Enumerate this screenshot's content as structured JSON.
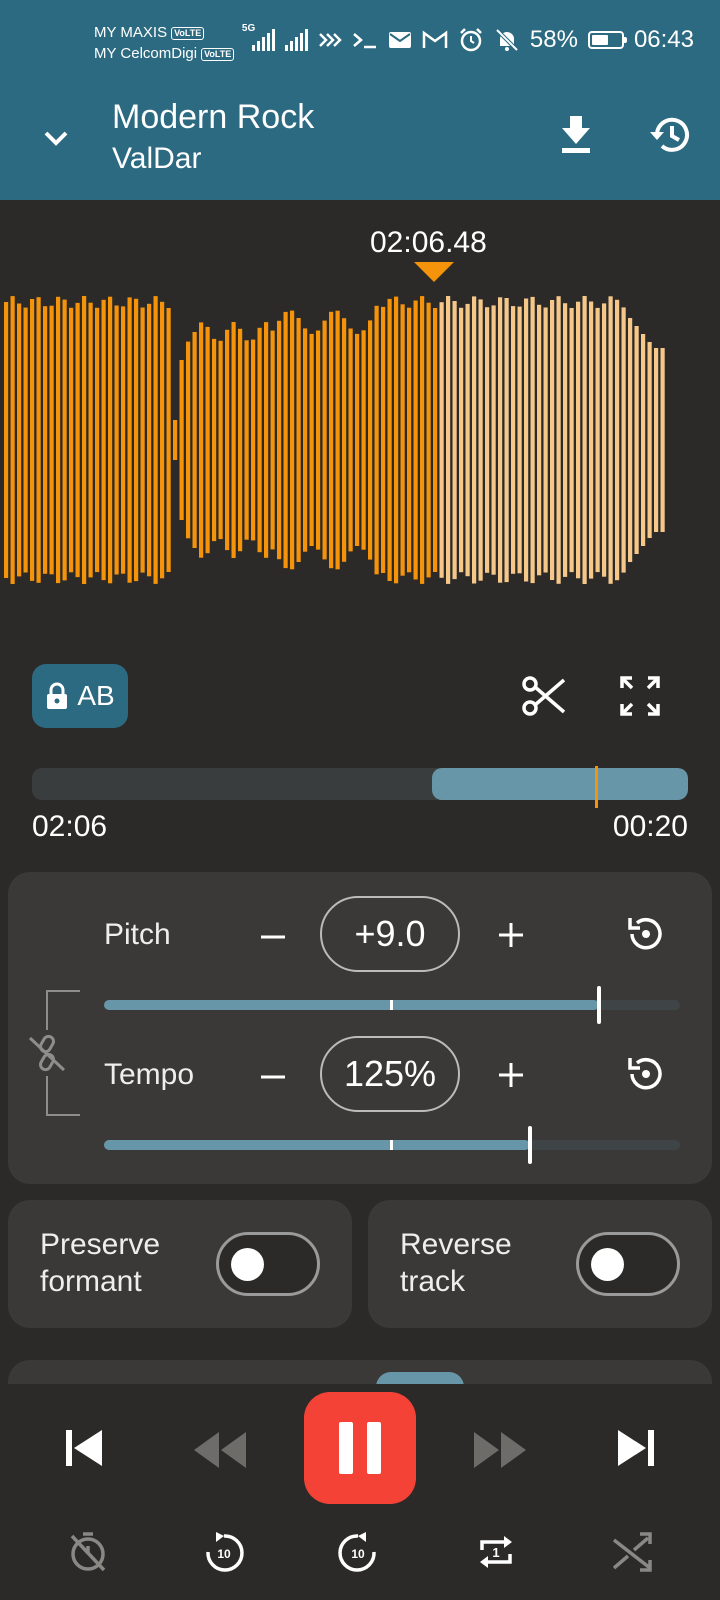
{
  "status_bar": {
    "carrier1": "MY MAXIS",
    "carrier2": "MY CelcomDigi",
    "volte": "VoLTE",
    "network": "5G",
    "battery": "58%",
    "battery_level": 0.58,
    "time": "06:43"
  },
  "header": {
    "title": "Modern Rock",
    "artist": "ValDar"
  },
  "waveform": {
    "position": "02:06.48",
    "played_color": "#f5930a",
    "unplayed_color": "#f5c88a"
  },
  "ab": {
    "label": "AB"
  },
  "range": {
    "start_label": "02:06",
    "end_label": "00:20",
    "selection_start": 0.61,
    "selection_end": 1.0,
    "marker": 0.86
  },
  "pitch": {
    "label": "Pitch",
    "value": "+9.0",
    "minus": "−",
    "plus": "+",
    "slider_level": 0.86
  },
  "tempo": {
    "label": "Tempo",
    "value": "125%",
    "minus": "−",
    "plus": "+",
    "slider_level": 0.74
  },
  "options": {
    "preserve_formant": {
      "label_line1": "Preserve",
      "label_line2": "formant",
      "on": false
    },
    "reverse_track": {
      "label_line1": "Reverse",
      "label_line2": "track",
      "on": false
    }
  },
  "colors": {
    "accent": "#2b6a80",
    "orange": "#f5930a",
    "pause": "#f44336",
    "slider": "#6796a8"
  },
  "player": {
    "icons": [
      "skip-previous-icon",
      "rewind-icon",
      "pause-icon",
      "fast-forward-icon",
      "skip-next-icon",
      "timer-off-icon",
      "replay-10-icon",
      "forward-10-icon",
      "repeat-one-icon",
      "shuffle-off-icon"
    ],
    "replay_seconds": "10",
    "forward_seconds": "10",
    "repeat_count": "1"
  }
}
